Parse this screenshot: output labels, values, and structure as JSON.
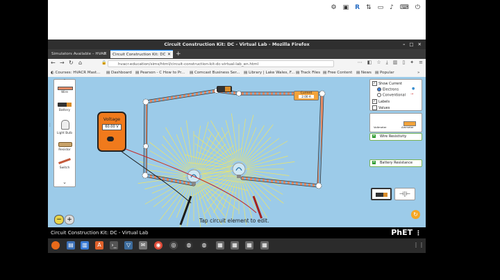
{
  "system": {
    "icons": [
      "settings-icon",
      "screenshot-icon",
      "r-icon",
      "network-icon",
      "display-icon",
      "volume-icon",
      "keyboard-icon",
      "power-icon"
    ]
  },
  "window": {
    "title": "Circuit Construction Kit: DC - Virtual Lab - Mozilla Firefox"
  },
  "tabs": [
    {
      "label": "Simulators Available – HVAC",
      "active": false
    },
    {
      "label": "Circuit Construction Kit: DC",
      "active": true
    }
  ],
  "nav": {
    "url": "hvacr.education/sims/html/circuit-construction-kit-dc-virtual-lab_en.html"
  },
  "bookmarks": [
    "Courses: HVACR Mast...",
    "Dashboard",
    "Pearson - C How to Pr...",
    "Comcast Business Ser...",
    "Library | Lake Wales, F...",
    "Track Files",
    "Free Content",
    "News",
    "Popular"
  ],
  "toolbox": {
    "items": [
      "Wire",
      "Battery",
      "Light Bulb",
      "Resistor",
      "Switch"
    ]
  },
  "voltmeter": {
    "label": "Voltage",
    "reading": "60.00 V"
  },
  "ammeter": {
    "label": "Current",
    "reading": "2.00 A"
  },
  "controls": {
    "show_current": "Show Current",
    "electrons": "Electrons",
    "conventional": "Conventional",
    "labels": "Labels",
    "values": "Values",
    "voltmeter": "Voltmeter",
    "ammeter": "Ammeter",
    "wire_resistivity": "Wire Resistivity",
    "battery_resistance": "Battery Resistance"
  },
  "sim": {
    "hint": "Tap circuit element to edit.",
    "footer_title": "Circuit Construction Kit: DC - Virtual Lab",
    "brand": "PhET"
  },
  "colors": {
    "canvas": "#9ccbe9",
    "voltmeter_body": "#f07a1c",
    "wire_core": "#e48a64",
    "accent_green": "#78b255"
  }
}
